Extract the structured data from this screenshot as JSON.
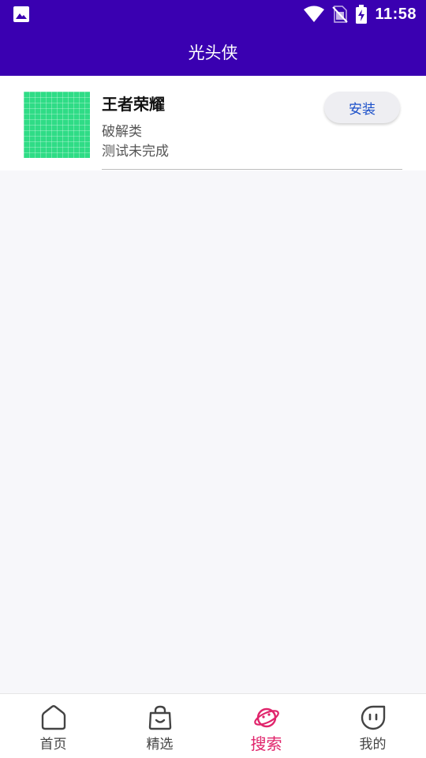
{
  "status_bar": {
    "time": "11:58",
    "icons": [
      "image-icon",
      "wifi-icon",
      "no-sim-icon",
      "battery-charging-icon"
    ]
  },
  "app_bar": {
    "title": "光头侠"
  },
  "app_list": [
    {
      "name": "王者荣耀",
      "category": "破解类",
      "status": "测试未完成",
      "button_label": "安装"
    }
  ],
  "bottom_nav": {
    "items": [
      {
        "label": "首页",
        "icon": "home-icon",
        "active": false
      },
      {
        "label": "精选",
        "icon": "shopping-bag-icon",
        "active": false
      },
      {
        "label": "搜索",
        "icon": "planet-icon",
        "active": true
      },
      {
        "label": "我的",
        "icon": "face-icon",
        "active": false
      }
    ]
  },
  "colors": {
    "primary": "#3a00b1",
    "active_tab": "#e0246b",
    "install_text": "#1a4fc9",
    "thumb_green": "#2fdc86"
  }
}
